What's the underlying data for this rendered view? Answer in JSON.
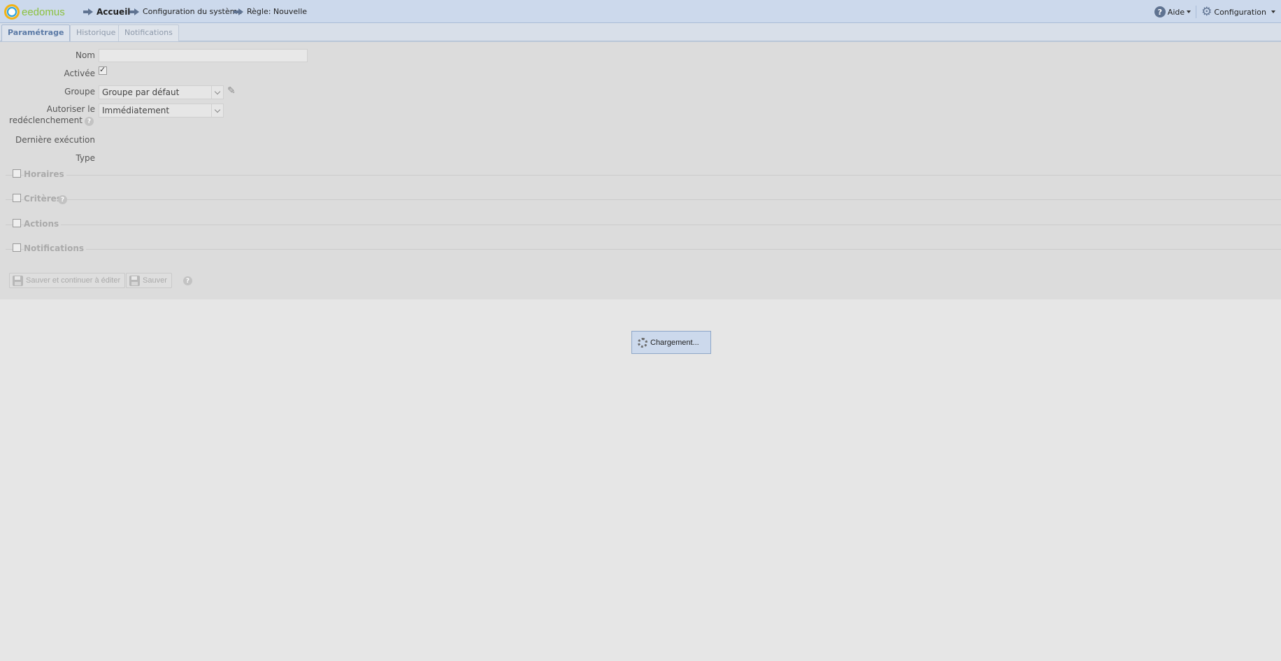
{
  "header": {
    "logo_text": "eedomus",
    "breadcrumb": [
      {
        "label": "Accueil"
      },
      {
        "label": "Configuration du système"
      },
      {
        "label": "Règle: Nouvelle"
      }
    ],
    "help_label": "Aide",
    "config_label": "Configuration"
  },
  "tabs": [
    {
      "label": "Paramétrage",
      "active": true
    },
    {
      "label": "Historique",
      "active": false
    },
    {
      "label": "Notifications",
      "active": false
    }
  ],
  "form": {
    "nom_label": "Nom",
    "nom_value": "",
    "activee_label": "Activée",
    "activee_checked": true,
    "groupe_label": "Groupe",
    "groupe_value": "Groupe par défaut",
    "autoriser_label_1": "Autoriser le",
    "autoriser_label_2": "redéclenchement",
    "autoriser_value": "Immédiatement",
    "derniere_label": "Dernière exécution",
    "type_label": "Type"
  },
  "sections": [
    {
      "label": "Horaires"
    },
    {
      "label": "Critères"
    },
    {
      "label": "Actions"
    },
    {
      "label": "Notifications"
    }
  ],
  "buttons": {
    "save_continue_label": "Sauver et continuer à éditer",
    "save_label": "Sauver"
  },
  "loading": {
    "label": "Chargement..."
  },
  "colors": {
    "header_bg": "#ccd9ec",
    "logo_green": "#8cc13f",
    "active_tab": "#5b7aa6"
  }
}
